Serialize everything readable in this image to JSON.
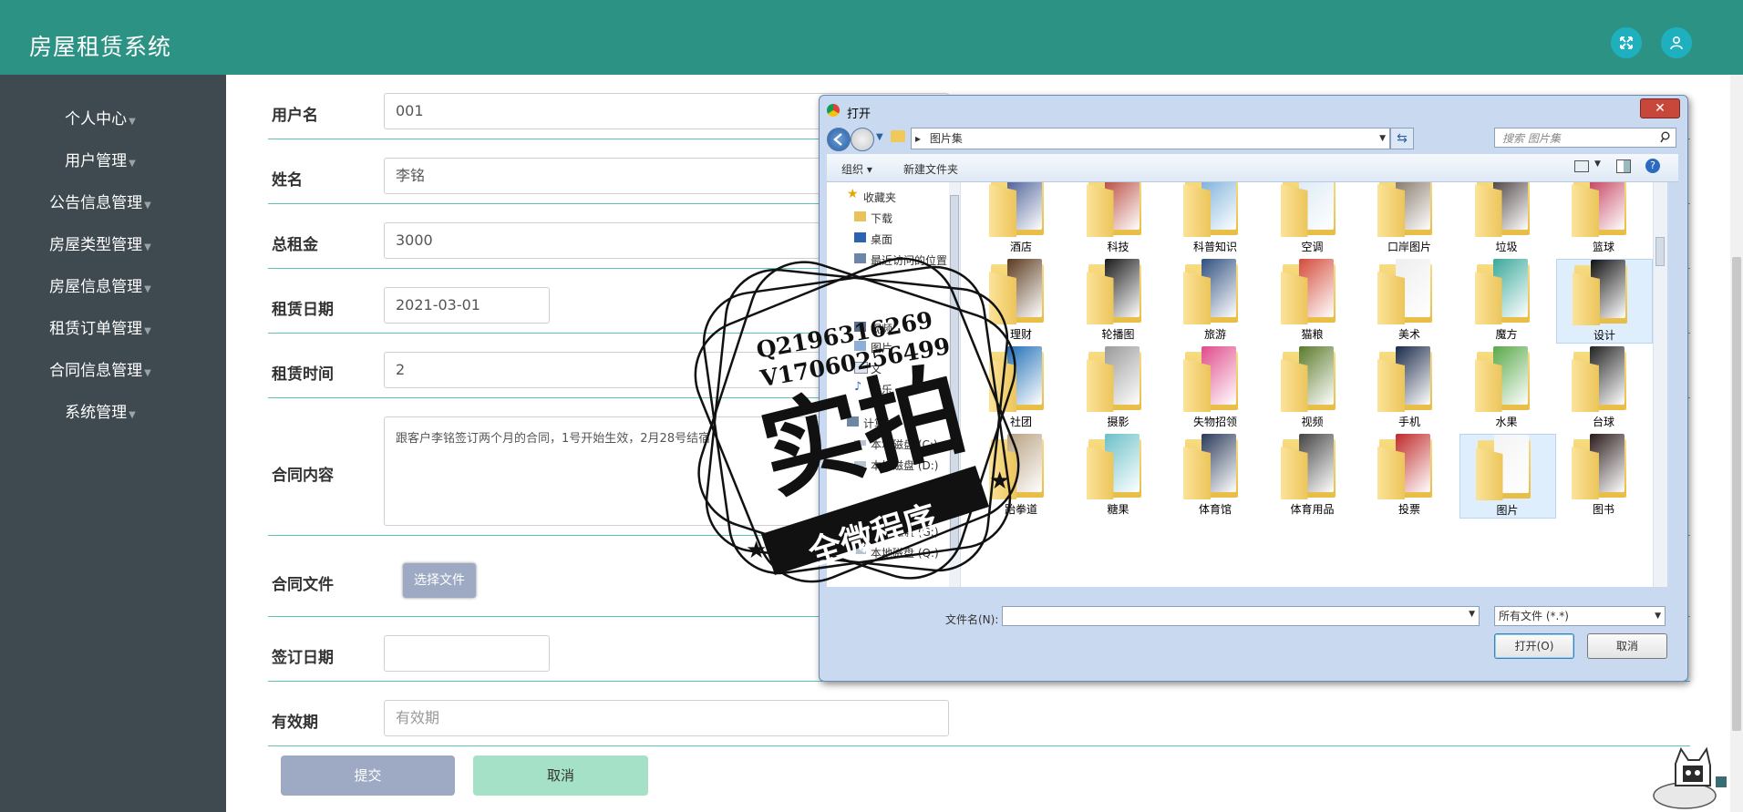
{
  "app": {
    "title": "房屋租赁系统"
  },
  "sidebar": {
    "items": [
      {
        "label": "个人中心"
      },
      {
        "label": "用户管理"
      },
      {
        "label": "公告信息管理"
      },
      {
        "label": "房屋类型管理"
      },
      {
        "label": "房屋信息管理"
      },
      {
        "label": "租赁订单管理"
      },
      {
        "label": "合同信息管理"
      },
      {
        "label": "系统管理"
      }
    ]
  },
  "form": {
    "username_label": "用户名",
    "username_value": "001",
    "name_label": "姓名",
    "name_value": "李铭",
    "rent_label": "总租金",
    "rent_value": "3000",
    "lease_date_label": "租赁日期",
    "lease_date_value": "2021-03-01",
    "lease_time_label": "租赁时间",
    "lease_time_value": "2",
    "contract_content_label": "合同内容",
    "contract_content_value": "跟客户李铭签订两个月的合同，1号开始生效，2月28号结宿",
    "contract_file_label": "合同文件",
    "choose_file": "选择文件",
    "sign_date_label": "签订日期",
    "validity_label": "有效期",
    "validity_placeholder": "有效期",
    "submit": "提交",
    "cancel": "取消"
  },
  "dialog": {
    "title": "打开",
    "address": "图片集",
    "search_placeholder": "搜索 图片集",
    "organize": "组织 ▾",
    "new_folder": "新建文件夹",
    "tree": [
      "收藏夹",
      "下载",
      "桌面",
      "最近访问的位置",
      "视频",
      "图片",
      "文",
      "音乐",
      "计算机",
      "本地磁盘 (C:)",
      "本地磁盘 (D:)",
      "本地磁盘 (G:)",
      "本地磁盘 (Q:)"
    ],
    "folders_row1": [
      "酒店",
      "科技",
      "科普知识",
      "空调",
      "口岸图片",
      "垃圾",
      "篮球"
    ],
    "folders_row2": [
      "理财",
      "轮播图",
      "旅游",
      "猫粮",
      "美术",
      "魔方",
      "设计"
    ],
    "folders_row3": [
      "社团",
      "摄影",
      "失物招领",
      "视频",
      "手机",
      "水果",
      "台球"
    ],
    "folders_row4": [
      "跆拳道",
      "糖果",
      "体育馆",
      "体育用品",
      "投票",
      "图片",
      "图书"
    ],
    "filename_label": "文件名(N):",
    "filter": "所有文件 (*.*)",
    "open": "打开(O)",
    "cancel": "取消"
  },
  "watermark": {
    "line1": "Q2196316269",
    "line2": "V17060256499",
    "big": "实拍",
    "banner": "全微程序"
  },
  "colors": {
    "header": "#2c9384",
    "sidebar": "#3f4a50",
    "accent_line": "#5bc4b4",
    "submit": "#9ea9c4",
    "cancel": "#a5e1c6"
  },
  "icons": {
    "fullscreen": "fullscreen-icon",
    "user": "user-icon"
  }
}
